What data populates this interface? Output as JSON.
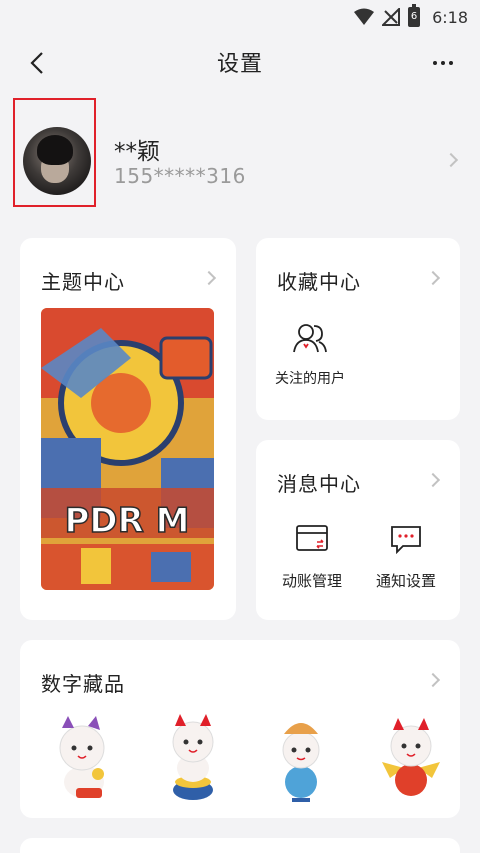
{
  "status_bar": {
    "time": "6:18",
    "battery": "6"
  },
  "header": {
    "title": "设置",
    "back_icon": "chevron-left-icon",
    "more_icon": "more-dots-icon"
  },
  "profile": {
    "name": "**颖",
    "phone": "155*****316"
  },
  "cards": {
    "theme": {
      "title": "主题中心",
      "preview_text": "PDR M"
    },
    "favorites": {
      "title": "收藏中心",
      "items": [
        {
          "label": "关注的用户",
          "icon": "users-icon"
        }
      ]
    },
    "messages": {
      "title": "消息中心",
      "items": [
        {
          "label": "动账管理",
          "icon": "card-transfer-icon"
        },
        {
          "label": "通知设置",
          "icon": "message-bubble-icon"
        }
      ]
    },
    "nft": {
      "title": "数字藏品",
      "items": [
        {
          "name": "lucky-cat-purple-icon"
        },
        {
          "name": "lucky-cat-pot-icon"
        },
        {
          "name": "lucky-cat-hat-icon"
        },
        {
          "name": "lucky-cat-wings-icon"
        }
      ]
    }
  },
  "colors": {
    "accent": "#e0202a",
    "background": "#f3f3f5",
    "muted_text": "#9a9a9a"
  }
}
